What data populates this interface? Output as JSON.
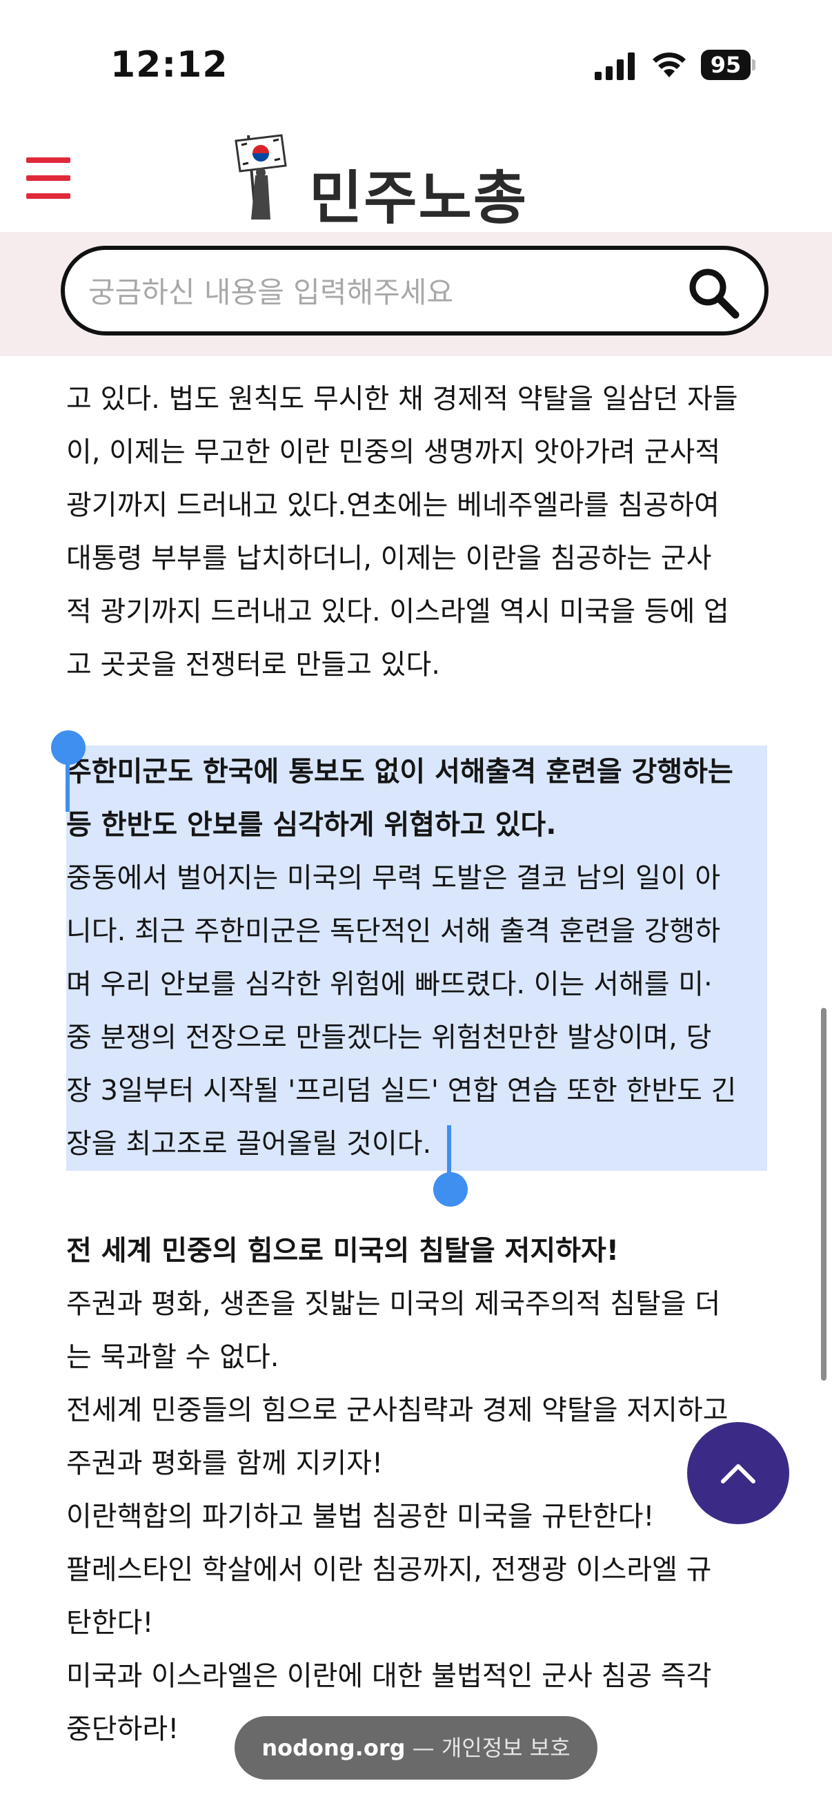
{
  "status_bar": {
    "time": "12:12",
    "battery": "95"
  },
  "header": {
    "logo_text": "민주노총"
  },
  "search": {
    "placeholder": "궁금하신 내용을 입력해주세요"
  },
  "article": {
    "para1": [
      "고 있다. 법도 원칙도 무시한 채 경제적 약탈을 일삼던 자들",
      "이, 이제는 무고한 이란 민중의 생명까지 앗아가려 군사적",
      "광기까지 드러내고 있다.연초에는 베네주엘라를 침공하여",
      "대통령 부부를 납치하더니, 이제는 이란을 침공하는 군사",
      "적 광기까지 드러내고 있다. 이스라엘 역시 미국을 등에 업",
      "고 곳곳을 전쟁터로 만들고 있다."
    ],
    "heading2": [
      "주한미군도 한국에 통보도 없이 서해출격 훈련을 강행하는",
      "등 한반도 안보를 심각하게 위협하고 있다."
    ],
    "para2": [
      "중동에서 벌어지는 미국의 무력 도발은 결코 남의 일이 아",
      "니다. 최근 주한미군은 독단적인 서해 출격 훈련을 강행하",
      "며 우리 안보를 심각한 위험에 빠뜨렸다. 이는 서해를 미·",
      "중 분쟁의 전장으로 만들겠다는 위험천만한 발상이며, 당",
      "장 3일부터 시작될 '프리덤 실드' 연합 연습 또한 한반도 긴",
      "장을 최고조로 끌어올릴 것이다."
    ],
    "heading3": "전 세계 민중의 힘으로 미국의 침탈을 저지하자!",
    "para3": [
      "주권과 평화, 생존을 짓밟는 미국의 제국주의적 침탈을 더",
      "는 묵과할 수 없다.",
      "전세계 민중들의 힘으로 군사침략과 경제 약탈을 저지하고",
      "주권과 평화를 함께 지키자!",
      "이란핵합의 파기하고 불법 침공한 미국을 규탄한다!",
      "팔레스타인 학살에서 이란 침공까지, 전쟁광 이스라엘 규",
      "탄한다!",
      "미국과 이스라엘은 이란에 대한 불법적인 군사 침공 즉각",
      "중단하라!"
    ]
  },
  "url_bar": {
    "domain": "nodong.org",
    "separator": " — ",
    "privacy": "개인정보 보호"
  },
  "colors": {
    "accent_red": "#e02a3a",
    "selection": "#d9e6fb",
    "handle": "#3f8ff0",
    "top_button": "#3b2a86",
    "search_band": "#f6ecee"
  },
  "icons": [
    "menu-icon",
    "search-icon",
    "chevron-up-icon",
    "signal-icon",
    "wifi-icon",
    "battery-icon",
    "flag-logo-icon"
  ]
}
